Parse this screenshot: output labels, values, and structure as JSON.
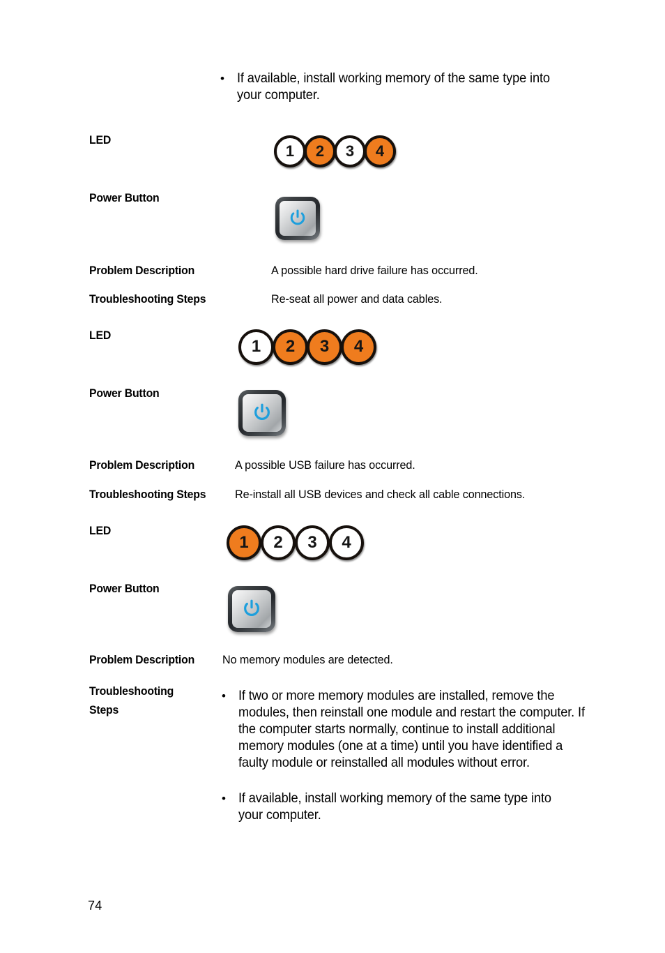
{
  "document": {
    "page_number": "74",
    "colors": {
      "led_on": "#ef7c1e",
      "led_off": "#ffffff",
      "led_outline": "#16100c",
      "power_symbol": "#1d9fdd",
      "text": "#000000"
    }
  },
  "top_bullets": [
    {
      "marker": "•",
      "text": "If available, install working memory of the same type into your computer."
    }
  ],
  "labels": {
    "led": "LED",
    "power_button": "Power Button",
    "problem_description": "Problem Description",
    "troubleshooting_steps": "Troubleshooting Steps",
    "troubleshooting_steps_wrapped": "Troubleshooting\nSteps"
  },
  "blocks": [
    {
      "led_label": "LED",
      "leds": [
        {
          "number": "1",
          "state": "off"
        },
        {
          "number": "2",
          "state": "on"
        },
        {
          "number": "3",
          "state": "off"
        },
        {
          "number": "4",
          "state": "on"
        }
      ],
      "power_button_label": "Power Button",
      "power_button_icon": "power-icon",
      "problem_description_label": "Problem Description",
      "problem_description": "A possible hard drive failure has occurred.",
      "troubleshooting_label": "Troubleshooting Steps",
      "troubleshooting_text": "Re-seat all power and data cables."
    },
    {
      "led_label": "LED",
      "leds": [
        {
          "number": "1",
          "state": "off"
        },
        {
          "number": "2",
          "state": "on"
        },
        {
          "number": "3",
          "state": "on"
        },
        {
          "number": "4",
          "state": "on"
        }
      ],
      "power_button_label": "Power Button",
      "power_button_icon": "power-icon",
      "problem_description_label": "Problem Description",
      "problem_description": "A possible USB failure has occurred.",
      "troubleshooting_label": "Troubleshooting Steps",
      "troubleshooting_text": "Re-install all USB devices and check all cable connections."
    },
    {
      "led_label": "LED",
      "leds": [
        {
          "number": "1",
          "state": "on"
        },
        {
          "number": "2",
          "state": "off"
        },
        {
          "number": "3",
          "state": "off"
        },
        {
          "number": "4",
          "state": "off"
        }
      ],
      "power_button_label": "Power Button",
      "power_button_icon": "power-icon",
      "problem_description_label": "Problem Description",
      "problem_description": "No memory modules are detected.",
      "troubleshooting_label": "Troubleshooting\nSteps",
      "troubleshooting_bullets": [
        {
          "marker": "•",
          "text": "If two or more memory modules are installed, remove the modules, then reinstall one module and restart the computer. If the computer starts normally, continue to install additional memory modules (one at a time) until you have identified a faulty module or reinstalled all modules without error."
        },
        {
          "marker": "•",
          "text": "If available, install working memory of the same type into your computer."
        }
      ]
    }
  ]
}
